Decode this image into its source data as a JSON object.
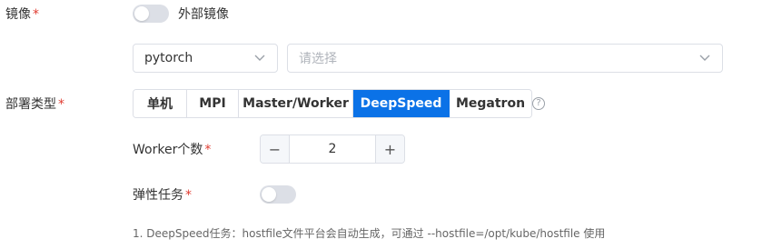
{
  "image_field": {
    "label": "镜像",
    "required_mark": "*",
    "external_toggle_label": "外部镜像",
    "external_toggle_on": false,
    "framework_select": {
      "value": "pytorch",
      "icon": "chevron-down-icon"
    },
    "version_select": {
      "placeholder": "请选择",
      "icon": "chevron-down-icon"
    }
  },
  "deploy_type": {
    "label": "部署类型",
    "required_mark": "*",
    "options": [
      "单机",
      "MPI",
      "Master/Worker",
      "DeepSpeed",
      "Megatron"
    ],
    "selected": "DeepSpeed",
    "help_icon": "?"
  },
  "worker_count": {
    "label": "Worker个数",
    "required_mark": "*",
    "value": "2",
    "minus": "−",
    "plus": "+"
  },
  "elastic_task": {
    "label": "弹性任务",
    "required_mark": "*",
    "toggle_on": false
  },
  "note": "1. DeepSpeed任务：hostfile文件平台会自动生成，可通过 --hostfile=/opt/kube/hostfile 使用",
  "colors": {
    "accent": "#0b72e7",
    "required": "#e03c31",
    "border": "#dcdfe6"
  }
}
